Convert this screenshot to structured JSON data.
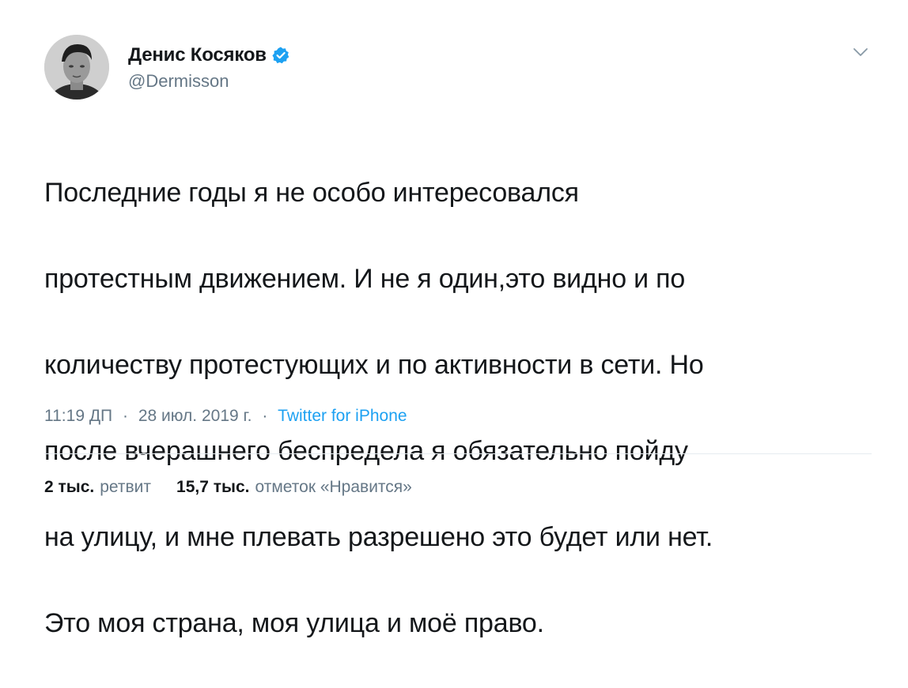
{
  "author": {
    "display_name": "Денис Косяков",
    "handle": "@Dermisson",
    "verified": true,
    "avatar_icon": "profile-photo"
  },
  "tweet": {
    "text_lines": [
      "Последние годы я не особо интересовался",
      "протестным движением. И не я один,это видно и по",
      "количеству протестующих  и по активности в сети. Но",
      "после вчерашнего беспредела я обязательно пойду",
      "на улицу, и мне плевать разрешено это будет или нет.",
      "Это моя страна, моя улица и моё право."
    ],
    "time": "11:19 ДП",
    "date": "28 июл. 2019 г.",
    "separator": "·",
    "source": "Twitter for iPhone"
  },
  "stats": {
    "retweets_count": "2 тыс.",
    "retweets_label": "ретвит",
    "likes_count": "15,7 тыс.",
    "likes_label": "отметок «Нравится»"
  },
  "colors": {
    "text": "#14171a",
    "secondary": "#657786",
    "accent": "#1da1f2",
    "divider": "#e6ecf0"
  },
  "icons": {
    "verified": "verified-badge-icon",
    "caret": "chevron-down-icon"
  }
}
